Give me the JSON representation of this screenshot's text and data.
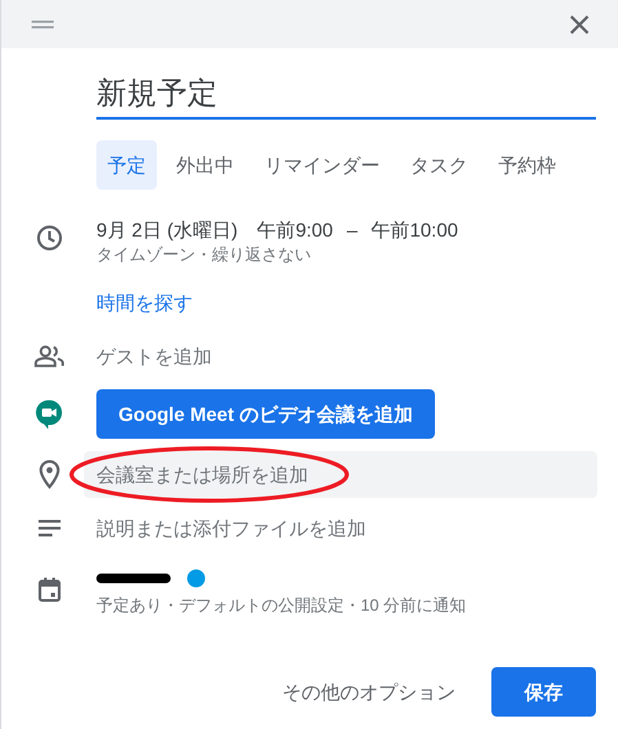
{
  "title_field": {
    "value": "新規予定"
  },
  "tabs": [
    {
      "label": "予定",
      "selected": true
    },
    {
      "label": "外出中",
      "selected": false
    },
    {
      "label": "リマインダー",
      "selected": false
    },
    {
      "label": "タスク",
      "selected": false
    },
    {
      "label": "予約枠",
      "selected": false
    }
  ],
  "date_time": {
    "date": "9月 2日 (水曜日)",
    "start": "午前9:00",
    "separator": "–",
    "end": "午前10:00",
    "details": "タイムゾーン・繰り返さない"
  },
  "find_time_link": "時間を探す",
  "guests": {
    "placeholder": "ゲストを追加"
  },
  "meet_button": "Google Meet のビデオ会議を追加",
  "location": {
    "placeholder": "会議室または場所を追加"
  },
  "description": {
    "placeholder": "説明または添付ファイルを追加"
  },
  "calendar": {
    "color": "#039be5",
    "details": "予定あり・デフォルトの公開設定・10 分前に通知"
  },
  "footer": {
    "more_options": "その他のオプション",
    "save": "保存"
  }
}
